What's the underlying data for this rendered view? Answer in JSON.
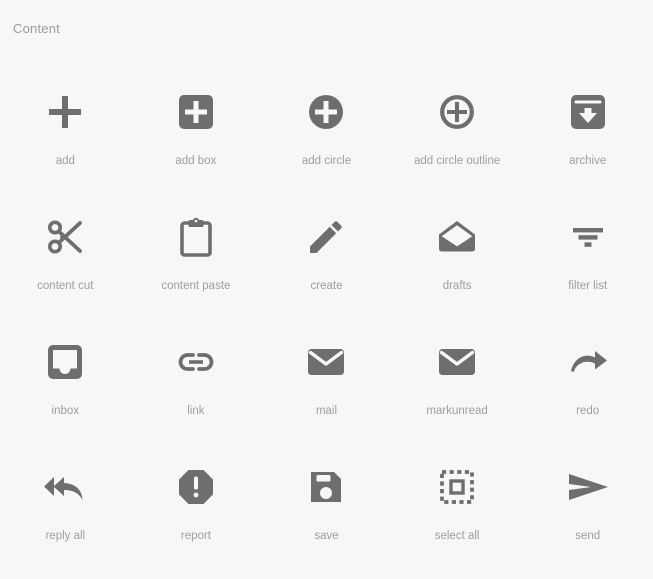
{
  "header": {
    "title": "Content"
  },
  "theme": {
    "background": "#f7f7f7",
    "icon_color": "#6e6e6e",
    "label_color": "#9e9e9e",
    "title_color": "#9b9b9b"
  },
  "grid": {
    "columns": 5,
    "rows": 4
  },
  "icons": [
    {
      "name": "add",
      "label": "add",
      "glyph": "add-icon"
    },
    {
      "name": "add_box",
      "label": "add box",
      "glyph": "add-box-icon"
    },
    {
      "name": "add_circle",
      "label": "add circle",
      "glyph": "add-circle-icon"
    },
    {
      "name": "add_circle_outline",
      "label": "add circle outline",
      "glyph": "add-circle-outline-icon"
    },
    {
      "name": "archive",
      "label": "archive",
      "glyph": "archive-icon"
    },
    {
      "name": "content_cut",
      "label": "content cut",
      "glyph": "content-cut-icon"
    },
    {
      "name": "content_paste",
      "label": "content paste",
      "glyph": "content-paste-icon"
    },
    {
      "name": "create",
      "label": "create",
      "glyph": "create-icon"
    },
    {
      "name": "drafts",
      "label": "drafts",
      "glyph": "drafts-icon"
    },
    {
      "name": "filter_list",
      "label": "filter list",
      "glyph": "filter-list-icon"
    },
    {
      "name": "inbox",
      "label": "inbox",
      "glyph": "inbox-icon"
    },
    {
      "name": "link",
      "label": "link",
      "glyph": "link-icon"
    },
    {
      "name": "mail",
      "label": "mail",
      "glyph": "mail-icon"
    },
    {
      "name": "markunread",
      "label": "markunread",
      "glyph": "markunread-icon"
    },
    {
      "name": "redo",
      "label": "redo",
      "glyph": "redo-icon"
    },
    {
      "name": "reply_all",
      "label": "reply all",
      "glyph": "reply-all-icon"
    },
    {
      "name": "report",
      "label": "report",
      "glyph": "report-icon"
    },
    {
      "name": "save",
      "label": "save",
      "glyph": "save-icon"
    },
    {
      "name": "select_all",
      "label": "select all",
      "glyph": "select-all-icon"
    },
    {
      "name": "send",
      "label": "send",
      "glyph": "send-icon"
    }
  ]
}
